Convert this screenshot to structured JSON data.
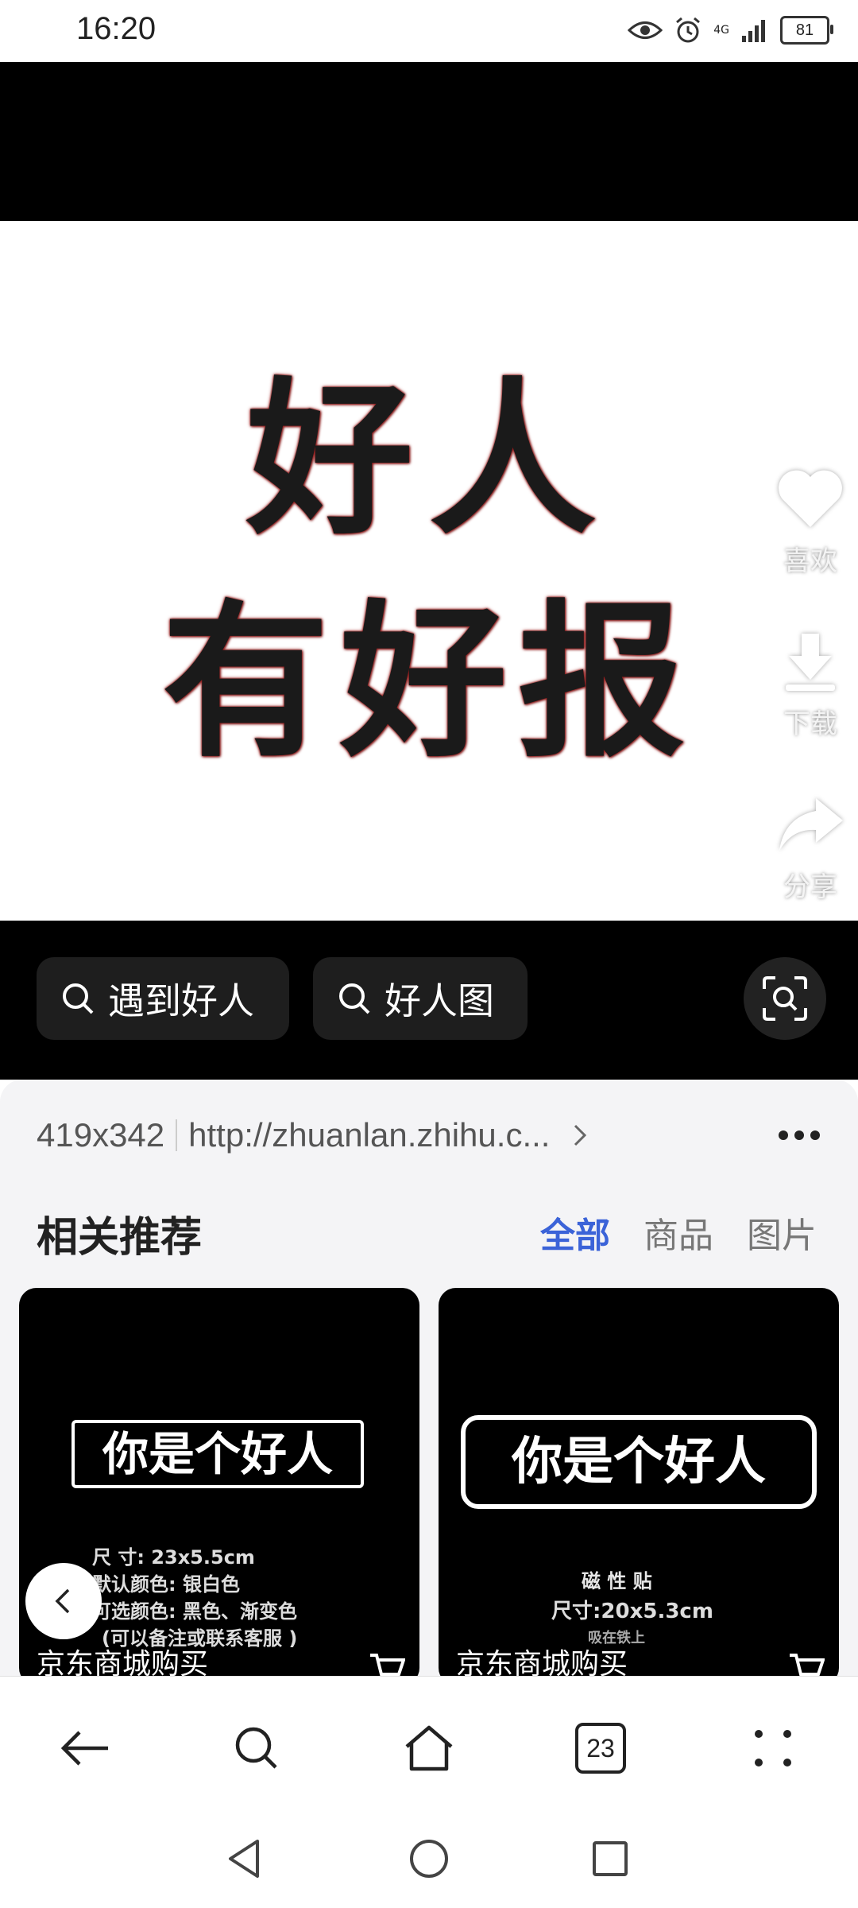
{
  "status_bar": {
    "time": "16:20",
    "network": "4G",
    "battery": "81"
  },
  "viewer": {
    "image_text_line1": "好人",
    "image_text_line2": "有好报",
    "actions": {
      "like_label": "喜欢",
      "download_label": "下载",
      "share_label": "分享"
    },
    "search_chips": [
      "遇到好人",
      "好人图"
    ]
  },
  "info": {
    "dimensions": "419x342",
    "source_url": "http://zhuanlan.zhihu.c..."
  },
  "recommendations": {
    "title": "相关推荐",
    "tabs": [
      {
        "label": "全部",
        "active": true
      },
      {
        "label": "商品",
        "active": false
      },
      {
        "label": "图片",
        "active": false
      }
    ],
    "cards": [
      {
        "sign_text": "你是个好人",
        "spec_lines": [
          "尺    寸: 23x5.5cm",
          "默认颜色: 银白色",
          "可选颜色: 黑色、渐变色",
          "(可以备注或联系客服 )"
        ],
        "buy_label": "京东商城购买"
      },
      {
        "sign_text": "你是个好人",
        "spec_lines": [
          "磁 性 贴",
          "尺寸:20x5.3cm",
          "吸在铁上"
        ],
        "buy_label": "京东商城购买"
      }
    ]
  },
  "toolbar": {
    "tab_count": "23"
  },
  "colors": {
    "accent": "#3b63d8",
    "viewer_bg": "#000000",
    "panel_bg": "#f4f4f6"
  }
}
